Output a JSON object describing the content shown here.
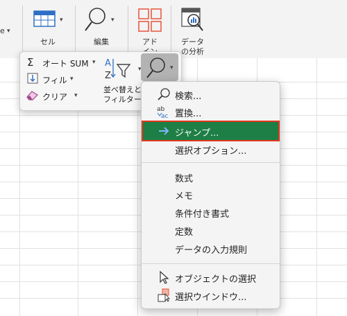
{
  "ribbon": {
    "cell_label": "セル",
    "edit_label": "編集",
    "addin_label_1": "アド",
    "addin_label_2": "イン",
    "analysis_label_1": "データ",
    "analysis_label_2": "の分析",
    "left_partial": "e"
  },
  "edit_panel": {
    "autosum_label": "オート SUM",
    "fill_label": "フィル",
    "clear_label": "クリア",
    "sort_filter_label_1": "並べ替えと",
    "sort_filter_label_2": "フィルター"
  },
  "menu": {
    "items": [
      {
        "label": "検索...",
        "icon": "search-icon"
      },
      {
        "label": "置換...",
        "icon": "replace-icon"
      },
      {
        "label": "ジャンプ...",
        "icon": "arrow-right-icon"
      },
      {
        "label": "選択オプション...",
        "icon": ""
      },
      {
        "label": "数式",
        "icon": ""
      },
      {
        "label": "メモ",
        "icon": ""
      },
      {
        "label": "条件付き書式",
        "icon": ""
      },
      {
        "label": "定数",
        "icon": ""
      },
      {
        "label": "データの入力規則",
        "icon": ""
      },
      {
        "label": "オブジェクトの選択",
        "icon": "pointer-icon"
      },
      {
        "label": "選択ウインドウ...",
        "icon": "selection-pane-icon"
      }
    ],
    "selected_index": 2
  },
  "colors": {
    "highlight": "#1d7f45",
    "highlight_border": "#e2371c",
    "addin_red": "#e8533a"
  }
}
